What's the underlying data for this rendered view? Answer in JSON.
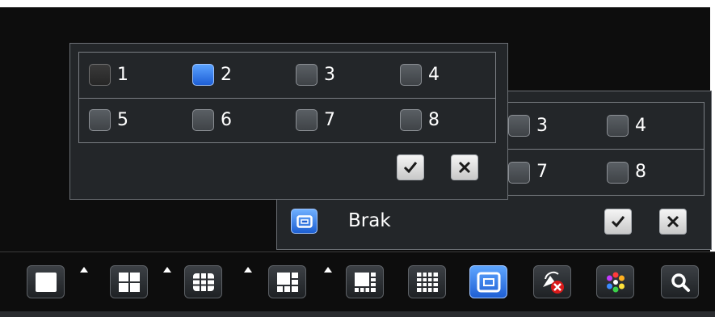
{
  "front_dialog": {
    "channels": [
      {
        "label": "1",
        "checked": false
      },
      {
        "label": "2",
        "checked": true
      },
      {
        "label": "3",
        "checked": false
      },
      {
        "label": "4",
        "checked": false
      },
      {
        "label": "5",
        "checked": false
      },
      {
        "label": "6",
        "checked": false
      },
      {
        "label": "7",
        "checked": false
      },
      {
        "label": "8",
        "checked": false
      }
    ]
  },
  "back_dialog": {
    "visible_channels": [
      {
        "label": "3",
        "checked": false
      },
      {
        "label": "4",
        "checked": false
      },
      {
        "label": "7",
        "checked": false
      },
      {
        "label": "8",
        "checked": false
      }
    ],
    "sequence_option_label": "Brak"
  },
  "taskbar": {
    "buttons": [
      {
        "name": "layout-1-icon"
      },
      {
        "name": "layout-4-icon"
      },
      {
        "name": "layout-9-icon"
      },
      {
        "name": "layout-6-icon"
      },
      {
        "name": "layout-8-icon"
      },
      {
        "name": "layout-16-icon"
      },
      {
        "name": "sequence-icon",
        "active": true
      },
      {
        "name": "ptz-icon"
      },
      {
        "name": "color-icon"
      },
      {
        "name": "search-icon"
      }
    ]
  },
  "colors": {
    "checked_blue": "#2d74ee",
    "panel_bg": "#232629",
    "screen_bg": "#0d0d0d"
  }
}
